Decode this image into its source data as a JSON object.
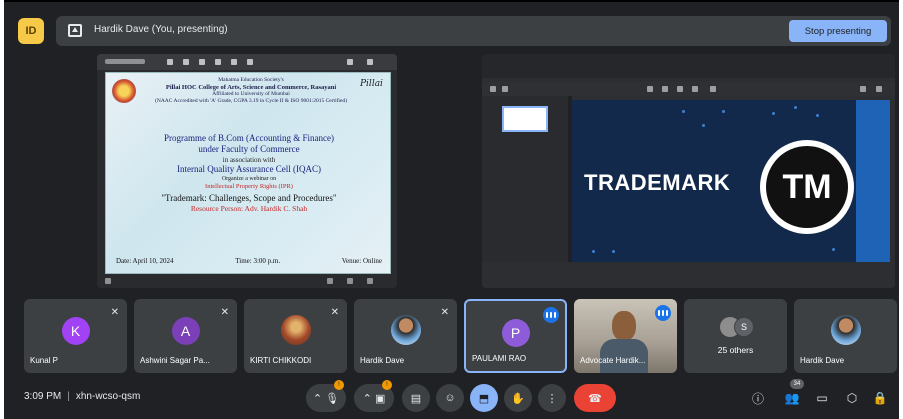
{
  "app": {
    "logo_text": "ID"
  },
  "presenting": {
    "label": "Hardik Dave (You, presenting)",
    "stop_button": "Stop presenting"
  },
  "poster": {
    "society": "Mahatma Education Society's",
    "college": "Pillai HOC College of Arts, Science and Commerce, Rasayani",
    "affiliation": "Affiliated to University of Mumbai",
    "naac": "(NAAC Accredited with 'A' Grade, CGPA 3.19 in Cycle II & ISO 9001:2015 Certified)",
    "programme": "Programme of B.Com (Accounting & Finance)",
    "faculty": "under Faculty of Commerce",
    "association": "in association with",
    "iqac": "Internal Quality Assurance Cell (IQAC)",
    "organize": "Organize a webinar on",
    "ipr": "Intellectual Property Rights (IPR)",
    "topic": "\"Trademark: Challenges, Scope and Procedures\"",
    "resource": "Resource Person: Adv. Hardik C. Shah",
    "date": "Date: April 10, 2024",
    "time": "Time: 3:00 p.m.",
    "venue": "Venue: Online"
  },
  "slide": {
    "title": "TRADEMARK",
    "badge": "TM"
  },
  "participants": [
    {
      "name": "Kunal P",
      "avatar": "K",
      "color": "#a142f4",
      "muted": true
    },
    {
      "name": "Ashwini Sagar Pa...",
      "avatar": "A",
      "color": "#7b3fb8",
      "muted": true
    },
    {
      "name": "KIRTI CHIKKODI",
      "avatar": "",
      "muted": true
    },
    {
      "name": "Hardik Dave",
      "avatar": "",
      "muted": true
    },
    {
      "name": "PAULAMI RAO",
      "avatar": "P",
      "color": "#8e5cd9",
      "speaking": true
    },
    {
      "name": "Advocate Hardik...",
      "speaking": true
    },
    {
      "name": "25 others",
      "others_letter": "S"
    },
    {
      "name": "Hardik Dave"
    }
  ],
  "bottom": {
    "time": "3:09 PM",
    "separator": "|",
    "meeting_code": "xhn-wcso-qsm",
    "participants_count": "34"
  }
}
